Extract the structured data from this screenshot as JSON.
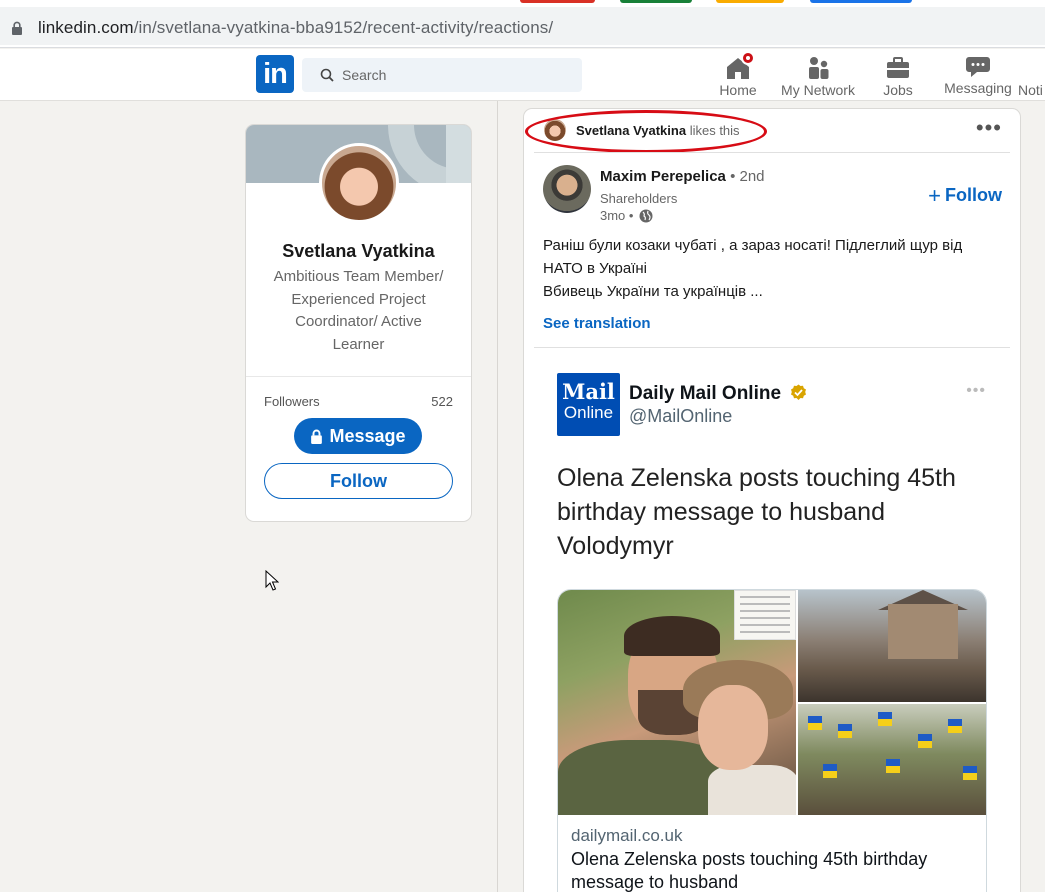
{
  "browser": {
    "url_host": "linkedin.com",
    "url_path": "/in/svetlana-vyatkina-bba9152/recent-activity/reactions/"
  },
  "nav": {
    "logo": "in",
    "search_placeholder": "Search",
    "items": [
      {
        "label": "Home",
        "icon": "home-icon"
      },
      {
        "label": "My Network",
        "icon": "network-icon"
      },
      {
        "label": "Jobs",
        "icon": "briefcase-icon"
      },
      {
        "label": "Messaging",
        "icon": "messaging-icon"
      },
      {
        "label": "Noti",
        "icon": "bell-icon"
      }
    ],
    "accent": "#0a66c2",
    "badge_color": "#cc1016"
  },
  "profile": {
    "name": "Svetlana Vyatkina",
    "headline": "Ambitious Team Member/ Experienced Project Coordinator/ Active Learner",
    "followers_label": "Followers",
    "followers_count": "522",
    "message_label": "Message",
    "follow_label": "Follow"
  },
  "post": {
    "reactor_name": "Svetlana Vyatkina",
    "reaction_text": "likes this",
    "author_name": "Maxim Perepelica",
    "author_degree": "• 2nd",
    "author_subtitle": "Shareholders",
    "author_time": "3mo •",
    "follow_label": "Follow",
    "text_lines": [
      "Раніш були козаки чубаті , а зараз носаті! Підлеглий щур від",
      "НАТО в Україні",
      "Вбивець України та українців ..."
    ],
    "see_translation": "See translation"
  },
  "tweet": {
    "logo_line1": "Mail",
    "logo_line2": "Online",
    "name": "Daily Mail Online",
    "handle": "@MailOnline",
    "headline": "Olena Zelenska posts touching 45th birthday message to husband Volodymyr",
    "link_domain": "dailymail.co.uk",
    "link_title": "Olena Zelenska posts touching 45th birthday message to husband"
  }
}
